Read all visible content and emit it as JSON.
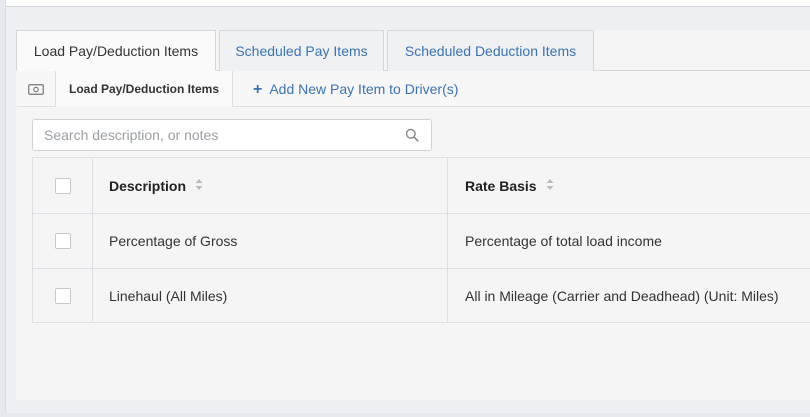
{
  "tabs": [
    {
      "label": "Load Pay/Deduction Items",
      "active": true
    },
    {
      "label": "Scheduled Pay Items",
      "active": false
    },
    {
      "label": "Scheduled Deduction Items",
      "active": false
    }
  ],
  "toolbar": {
    "icon": "money-bill-icon",
    "section_label": "Load Pay/Deduction Items",
    "add_label": "Add New Pay Item to Driver(s)"
  },
  "search": {
    "placeholder": "Search description, or notes",
    "value": ""
  },
  "table": {
    "columns": [
      "Description",
      "Rate Basis"
    ],
    "rows": [
      {
        "description": "Percentage of Gross",
        "rate_basis": "Percentage of total load income",
        "checked": false
      },
      {
        "description": "Linehaul (All Miles)",
        "rate_basis": "All in Mileage (Carrier and Deadhead) (Unit: Miles)",
        "checked": false
      }
    ]
  },
  "colors": {
    "link": "#3a73b4",
    "border": "#dcdfe3"
  }
}
